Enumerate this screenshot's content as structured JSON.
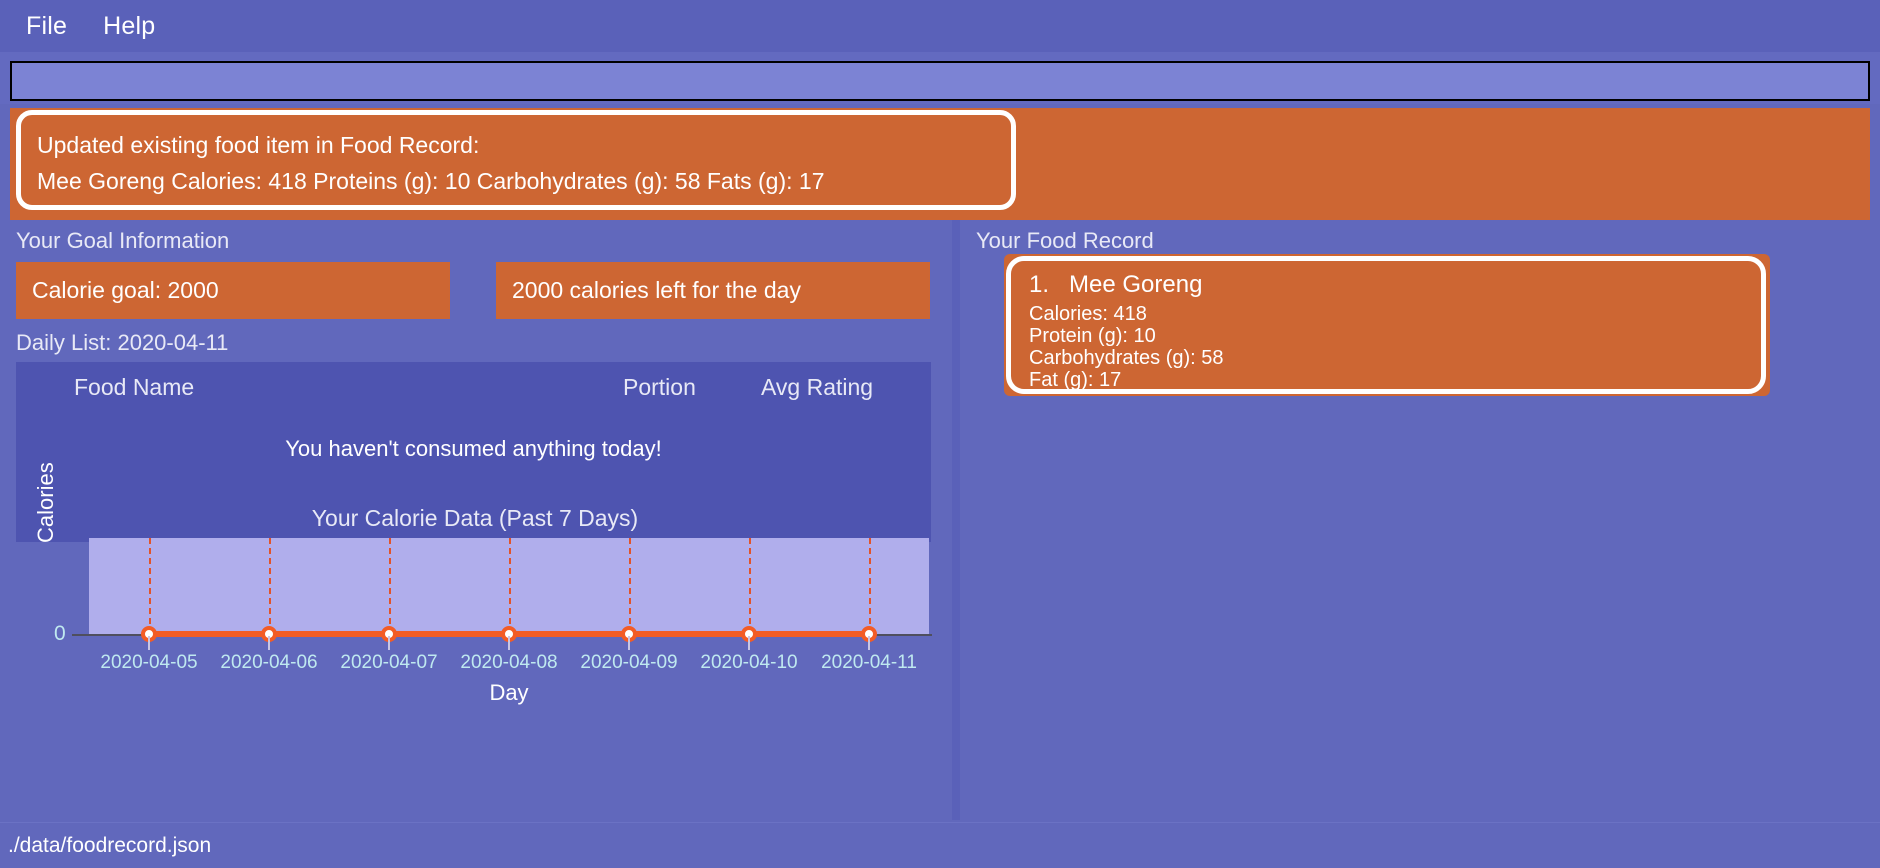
{
  "window": {
    "menu": [
      {
        "label": "File"
      },
      {
        "label": "Help"
      }
    ],
    "command_input": {
      "value": "",
      "placeholder": ""
    },
    "statusbar": {
      "path": "./data/foodrecord.json"
    }
  },
  "banner": {
    "line1": "Updated existing food item in Food Record:",
    "line2": "Mee Goreng Calories: 418 Proteins (g): 10 Carbohydrates (g): 58 Fats (g): 17"
  },
  "left_pane": {
    "goal_section_label": "Your Goal Information",
    "calorie_goal": "Calorie goal: 2000",
    "calories_left": "2000 calories left for the day",
    "daily_list_label": "Daily List: 2020-04-11",
    "table": {
      "headers": [
        "Food Name",
        "Portion",
        "Avg Rating"
      ],
      "rows": [],
      "empty_message": "You haven't consumed anything today!"
    }
  },
  "right_pane": {
    "section_label": "Your Food Record",
    "items": [
      {
        "index": "1.",
        "name": "Mee Goreng",
        "calories": "Calories: 418",
        "protein": "Protein (g): 10",
        "carbohydrates": "Carbohydrates (g): 58",
        "fat": "Fat (g): 17"
      }
    ]
  },
  "chart_data": {
    "type": "line",
    "title": "Your Calorie Data (Past 7 Days)",
    "xlabel": "Day",
    "ylabel": "Calories",
    "categories": [
      "2020-04-05",
      "2020-04-06",
      "2020-04-07",
      "2020-04-08",
      "2020-04-09",
      "2020-04-10",
      "2020-04-11"
    ],
    "values": [
      0,
      0,
      0,
      0,
      0,
      0,
      0
    ],
    "ytick_labels": [
      "0"
    ],
    "ylim": [
      0,
      1
    ],
    "grid": "vertical-dashed",
    "legend": "none",
    "series_color": "#f25c26",
    "plot_bg": "#b0aeec"
  },
  "colors": {
    "window_bg": "#6168bc",
    "accent_orange": "#cd6633",
    "panel_dark": "#4e54b0",
    "entry_bg": "#7c83d4",
    "tick_text": "#bfe9f0",
    "text": "#ffffff"
  }
}
